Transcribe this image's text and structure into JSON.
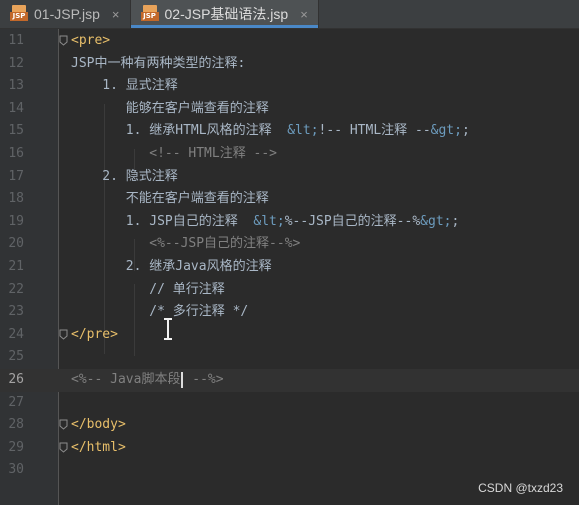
{
  "tabs": [
    {
      "label": "01-JSP.jsp",
      "icon": "jsp-file-icon"
    },
    {
      "label": "02-JSP基础语法.jsp",
      "icon": "jsp-file-icon",
      "active": true
    }
  ],
  "tab_close": "×",
  "jsp_icon_text": "JSP",
  "lines": [
    {
      "num": "11",
      "segments": [
        {
          "t": "<pre>",
          "c": "tag"
        }
      ],
      "fold": true
    },
    {
      "num": "12",
      "segments": [
        {
          "t": "JSP中一种有两种类型的注释:",
          "c": "txt"
        }
      ]
    },
    {
      "num": "13",
      "segments": [
        {
          "t": "    1. 显式注释",
          "c": "txt"
        }
      ]
    },
    {
      "num": "14",
      "segments": [
        {
          "t": "       能够在客户端查看的注释",
          "c": "txt"
        }
      ]
    },
    {
      "num": "15",
      "segments": [
        {
          "t": "       1. 继承HTML风格的注释  ",
          "c": "txt"
        },
        {
          "t": "&lt;",
          "c": "ent"
        },
        {
          "t": "!-- HTML注释 --",
          "c": "txt"
        },
        {
          "t": "&gt;",
          "c": "ent"
        },
        {
          "t": ";",
          "c": "txt"
        }
      ]
    },
    {
      "num": "16",
      "segments": [
        {
          "t": "          <!-- HTML注释 -->",
          "c": "cmt"
        }
      ]
    },
    {
      "num": "17",
      "segments": [
        {
          "t": "    2. 隐式注释",
          "c": "txt"
        }
      ]
    },
    {
      "num": "18",
      "segments": [
        {
          "t": "       不能在客户端查看的注释",
          "c": "txt"
        }
      ]
    },
    {
      "num": "19",
      "segments": [
        {
          "t": "       1. JSP自己的注释  ",
          "c": "txt"
        },
        {
          "t": "&lt;",
          "c": "ent"
        },
        {
          "t": "%--JSP自己的注释--%",
          "c": "txt"
        },
        {
          "t": "&gt;",
          "c": "ent"
        },
        {
          "t": ";",
          "c": "txt"
        }
      ]
    },
    {
      "num": "20",
      "segments": [
        {
          "t": "          <%--JSP自己的注释--%>",
          "c": "cmt"
        }
      ]
    },
    {
      "num": "21",
      "segments": [
        {
          "t": "       2. 继承Java风格的注释",
          "c": "txt"
        }
      ]
    },
    {
      "num": "22",
      "segments": [
        {
          "t": "          // 单行注释",
          "c": "txt"
        }
      ]
    },
    {
      "num": "23",
      "segments": [
        {
          "t": "          /* 多行注释 */",
          "c": "txt"
        }
      ]
    },
    {
      "num": "24",
      "segments": [
        {
          "t": "</pre>",
          "c": "tag"
        }
      ],
      "fold": true
    },
    {
      "num": "25",
      "segments": []
    },
    {
      "num": "26",
      "segments": [
        {
          "t": "<%-- Java脚本段",
          "c": "cmt"
        },
        {
          "t": "|caret|",
          "c": "caret"
        },
        {
          "t": " --%>",
          "c": "cmt"
        }
      ],
      "current": true
    },
    {
      "num": "27",
      "segments": []
    },
    {
      "num": "28",
      "segments": [
        {
          "t": "</body>",
          "c": "tag"
        }
      ],
      "fold": true
    },
    {
      "num": "29",
      "segments": [
        {
          "t": "</html>",
          "c": "tag"
        }
      ],
      "fold": true
    },
    {
      "num": "30",
      "segments": []
    }
  ],
  "watermark": "CSDN @txzd23",
  "colors": {
    "background": "#2b2b2b",
    "tag": "#e8bf6a",
    "text": "#a9b7c6",
    "entity": "#6d9cbe",
    "comment": "#808080",
    "tab_accent": "#4a88c7"
  }
}
